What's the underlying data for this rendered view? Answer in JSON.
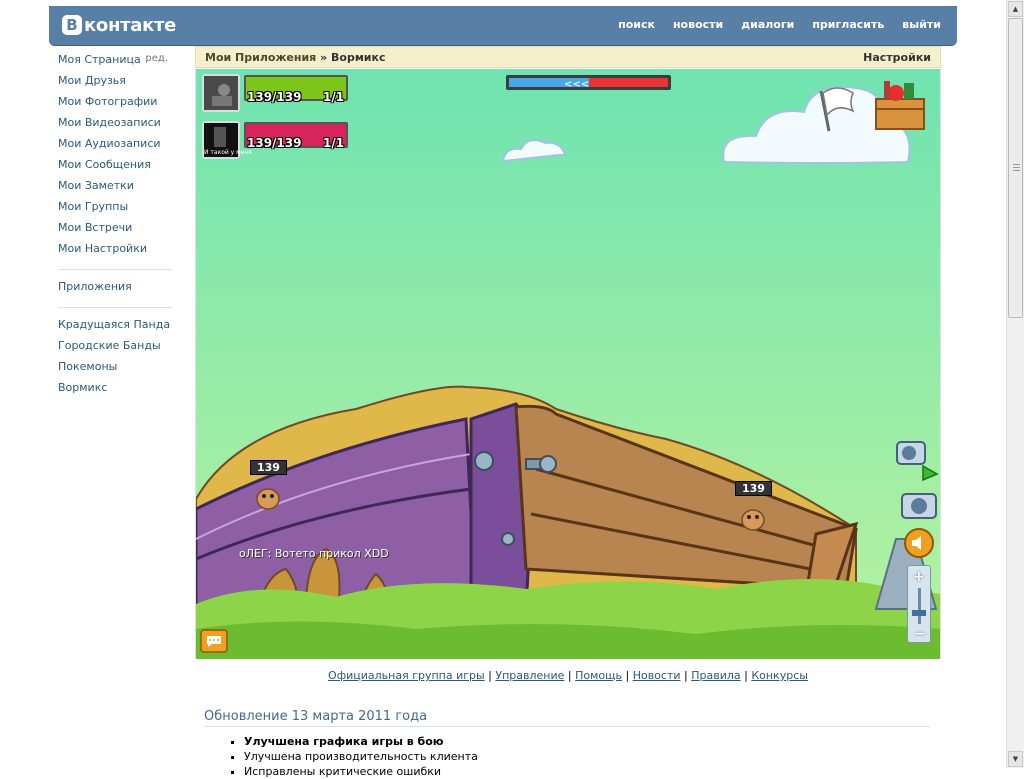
{
  "header": {
    "logo_letter": "B",
    "logo_text": "контакте",
    "nav": [
      "поиск",
      "новости",
      "диалоги",
      "пригласить",
      "выйти"
    ]
  },
  "leftmenu": {
    "edit": "ред.",
    "main": [
      "Моя Страница",
      "Мои Друзья",
      "Мои Фотографии",
      "Мои Видеозаписи",
      "Мои Аудиозаписи",
      "Мои Сообщения",
      "Мои Заметки",
      "Мои Группы",
      "Мои Встречи",
      "Мои Настройки"
    ],
    "apps": "Приложения",
    "games": [
      "Крадущаяся Панда",
      "Городские Банды",
      "Покемоны",
      "Вормикс"
    ]
  },
  "breadcrumb": {
    "parent": "Мои Приложения",
    "sep": " » ",
    "current": "Вормикс",
    "settings": "Настройки"
  },
  "game": {
    "player1": {
      "hp": "139/139",
      "count": "1/1",
      "health_fraction": 1.0,
      "bar_color": "#7cc61a"
    },
    "player2": {
      "hp": "139/139",
      "count": "1/1",
      "health_fraction": 1.0,
      "bar_color": "#d8245c"
    },
    "worm_left_hp": "139",
    "worm_right_hp": "139",
    "chat": {
      "name": "оЛЕГ:",
      "text": " Вотето прикол XDD"
    },
    "avatar2_caption": "И такой у меня"
  },
  "links": [
    "Официальная группа игры",
    "Управление",
    "Помощь",
    "Новости",
    "Правила",
    "Конкурсы"
  ],
  "update": {
    "title": "Обновление 13 марта 2011 года",
    "items": [
      "Улучшена графика игры в бою",
      "Улучшена производительность клиента",
      "Исправлены критические ошибки"
    ]
  }
}
